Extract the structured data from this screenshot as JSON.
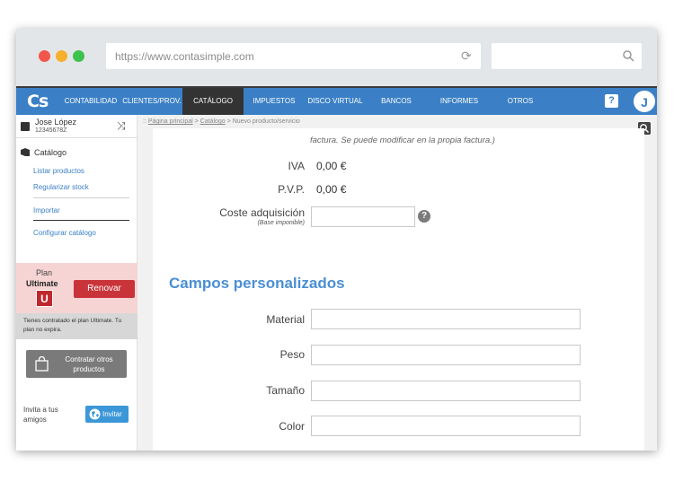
{
  "browser": {
    "url": "https://www.contasimple.com"
  },
  "nav": {
    "logo": "Cs",
    "items": [
      {
        "label": "CONTABILIDAD"
      },
      {
        "label": "CLIENTES/PROV."
      },
      {
        "label": "CATÁLOGO"
      },
      {
        "label": "IMPUESTOS"
      },
      {
        "label": "DISCO VIRTUAL"
      },
      {
        "label": "BANCOS"
      },
      {
        "label": "INFORMES"
      },
      {
        "label": "OTROS"
      }
    ],
    "active_index": 2,
    "help_label": "?",
    "avatar_initial": "J"
  },
  "user": {
    "name": "Jose López",
    "id": "12345678Z"
  },
  "sidebar": {
    "section_title": "Catálogo",
    "links": [
      {
        "label": "Listar productos"
      },
      {
        "label": "Regularizar stock"
      },
      {
        "label": "Importar"
      },
      {
        "label": "Configurar catálogo"
      }
    ],
    "plan": {
      "label": "Plan",
      "name": "Ultimate",
      "badge": "U",
      "renew_label": "Renovar",
      "info": "Tienes contratado el plan Ultimate. Tu plan no expira."
    },
    "contract_label": "Contratar otros productos",
    "invite_text": "Invita a tus amigos",
    "invite_label": "Invitar"
  },
  "breadcrumb": {
    "home": "Página principal",
    "section": "Catálogo",
    "current": "Nuevo producto/servicio",
    "sep": ">"
  },
  "form": {
    "note": "factura. Se puede modificar en la propia factura.)",
    "iva_label": "IVA",
    "iva_value": "0,00 €",
    "pvp_label": "P.V.P.",
    "pvp_value": "0,00 €",
    "coste_label": "Coste adquisición",
    "coste_sub": "(Base imponible)",
    "coste_value": "",
    "help_label": "?",
    "custom_title": "Campos personalizados",
    "custom_fields": [
      {
        "label": "Material",
        "value": ""
      },
      {
        "label": "Peso",
        "value": ""
      },
      {
        "label": "Tamaño",
        "value": ""
      },
      {
        "label": "Color",
        "value": ""
      }
    ]
  },
  "colors": {
    "nav_blue": "#3b80c6",
    "renew_red": "#c9343a",
    "section_title_blue": "#4a8fd3"
  }
}
